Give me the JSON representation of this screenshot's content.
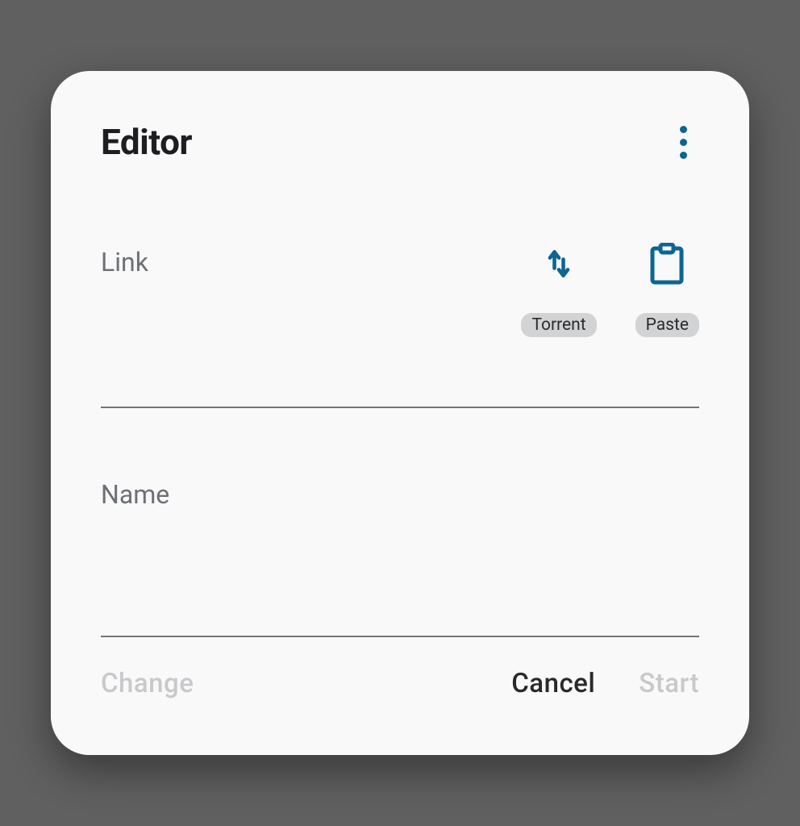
{
  "dialog": {
    "title": "Editor"
  },
  "link": {
    "label": "Link",
    "value": "",
    "torrent_chip": "Torrent",
    "paste_chip": "Paste"
  },
  "name": {
    "label": "Name",
    "value": ""
  },
  "footer": {
    "change": "Change",
    "cancel": "Cancel",
    "start": "Start"
  },
  "colors": {
    "accent": "#0c6592"
  }
}
